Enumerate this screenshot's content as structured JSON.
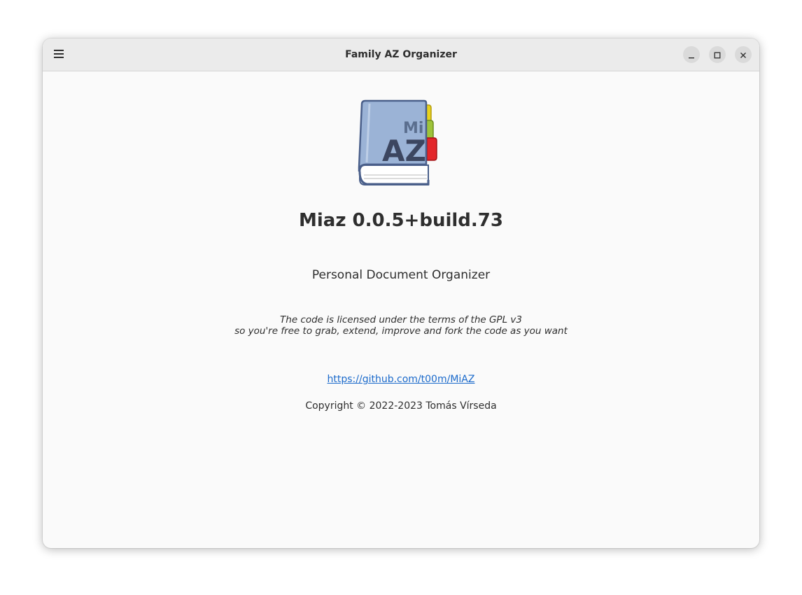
{
  "window": {
    "title": "Family AZ Organizer"
  },
  "header": {
    "menu_icon": "hamburger-menu-icon",
    "minimize_icon": "minimize-icon",
    "maximize_icon": "maximize-icon",
    "close_icon": "close-icon"
  },
  "about": {
    "logo_text_small": "Mi",
    "logo_text_large": "AZ",
    "app_name": "Miaz 0.0.5+build.73",
    "subtitle": "Personal Document Organizer",
    "license_line1": "The code is licensed under the terms of the  GPL v3",
    "license_line2": "so you're free to grab, extend, improve and fork the code as you want",
    "website": "https://github.com/t00m/MiAZ",
    "copyright": "Copyright © 2022-2023 Tomás Vírseda"
  },
  "colors": {
    "link": "#1b6acb",
    "book_cover": "#9bb3d6",
    "tab_yellow": "#e8d21c",
    "tab_green": "#9ec33a",
    "tab_red": "#e3262a"
  }
}
